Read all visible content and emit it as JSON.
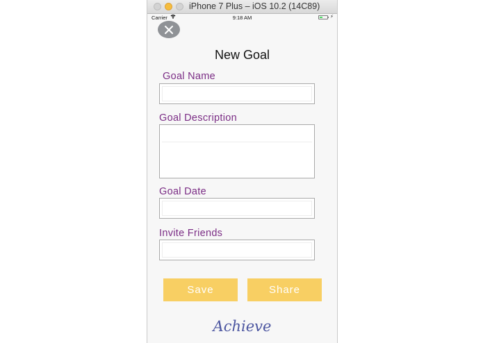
{
  "window": {
    "title": "iPhone 7 Plus – iOS 10.2 (14C89)"
  },
  "status_bar": {
    "carrier": "Carrier",
    "wifi_icon": "wifi-icon",
    "time": "9:18 AM",
    "battery_icon": "battery-icon",
    "battery_level": 0.35,
    "battery_color": "#4cd964"
  },
  "header": {
    "close_icon": "close-icon",
    "title": "New Goal"
  },
  "form": {
    "goal_name": {
      "label": "Goal Name",
      "value": "",
      "placeholder": ""
    },
    "goal_description": {
      "label": "Goal Description",
      "value": "",
      "placeholder": ""
    },
    "goal_date": {
      "label": "Goal Date",
      "value": "",
      "placeholder": ""
    },
    "invite_friends": {
      "label": "Invite Friends",
      "value": "",
      "placeholder": ""
    }
  },
  "actions": {
    "save_label": "Save",
    "share_label": "Share"
  },
  "footer": {
    "brand": "Achieve"
  },
  "colors": {
    "label": "#7b2d85",
    "button": "#f8cf63",
    "brand": "#4b55a0",
    "close_button": "#8f9296"
  }
}
